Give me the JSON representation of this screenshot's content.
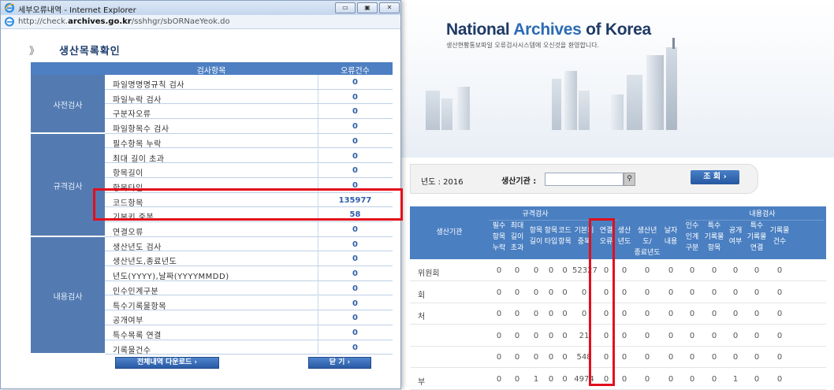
{
  "background_page": {
    "site_title_prefix": "National",
    "site_title_accent": "Archives",
    "site_title_suffix": "of Korea",
    "site_subtitle": "생산현황통보파일 오류검사시스템에 오신것을 환영합니다.",
    "search": {
      "year_label": "년도 : 2016",
      "agency_label": "생산기관 :",
      "agency_value": "",
      "query_button": "조 회 ›"
    },
    "table": {
      "col_agency": "생산기관",
      "group_format": "규격검사",
      "group_content": "내용검사",
      "columns": [
        "필수\n항목\n누락",
        "최대\n길이\n초과",
        "항목\n길이",
        "항목\n타입",
        "코드\n항목",
        "기본키\n중복",
        "연결\n오류",
        "생산\n년도",
        "생산년도/\n종료년도",
        "날자\n내용",
        "인수\n인계\n구분",
        "특수\n기록물\n항목",
        "공개\n여부",
        "특수\n기록물\n연결",
        "기록물\n건수"
      ],
      "rows": [
        {
          "name": "위원회",
          "values": [
            "0",
            "0",
            "0",
            "0",
            "0",
            "52327",
            "0",
            "0",
            "0",
            "0",
            "0",
            "0",
            "0",
            "0",
            "0"
          ]
        },
        {
          "name": "회",
          "values": [
            "0",
            "0",
            "0",
            "0",
            "0",
            "0",
            "0",
            "0",
            "0",
            "0",
            "0",
            "0",
            "0",
            "0",
            "0"
          ]
        },
        {
          "name": "처",
          "values": [
            "0",
            "0",
            "0",
            "0",
            "0",
            "0",
            "0",
            "0",
            "0",
            "0",
            "0",
            "0",
            "0",
            "0",
            "0"
          ]
        },
        {
          "name": "",
          "values": [
            "0",
            "0",
            "0",
            "0",
            "0",
            "21",
            "0",
            "0",
            "0",
            "0",
            "0",
            "0",
            "0",
            "0",
            "0"
          ]
        },
        {
          "name": "",
          "values": [
            "0",
            "0",
            "0",
            "0",
            "0",
            "548",
            "0",
            "0",
            "0",
            "0",
            "0",
            "0",
            "0",
            "0",
            "0"
          ]
        },
        {
          "name": "부",
          "values": [
            "0",
            "0",
            "1",
            "0",
            "0",
            "4974",
            "0",
            "0",
            "0",
            "0",
            "0",
            "0",
            "1",
            "0",
            "0"
          ]
        }
      ]
    }
  },
  "popup": {
    "window_title": "세부오류내역 - Internet Explorer",
    "url_prefix": "http://check.",
    "url_bold": "archives.go.kr",
    "url_suffix": "/sshhgr/sbORNaeYeok.do",
    "heading": "생산목록확인",
    "table": {
      "col_item": "검사항목",
      "col_count": "오류건수",
      "groups": [
        {
          "category": "사전검사",
          "rows": [
            {
              "label": "파일명명명규칙 검사",
              "count": "0"
            },
            {
              "label": "파일누락 검사",
              "count": "0"
            },
            {
              "label": "구분자오류",
              "count": "0"
            },
            {
              "label": "파일항목수 검사",
              "count": "0"
            }
          ]
        },
        {
          "category": "규격검사",
          "rows": [
            {
              "label": "필수항목 누락",
              "count": "0"
            },
            {
              "label": "최대 길이 초과",
              "count": "0"
            },
            {
              "label": "항목길이",
              "count": "0"
            },
            {
              "label": "항목타입",
              "count": "0"
            },
            {
              "label": "코드항목",
              "count": "135977"
            },
            {
              "label": "기본키 중복",
              "count": "58"
            },
            {
              "label": "연결오류",
              "count": "0"
            }
          ]
        },
        {
          "category": "내용검사",
          "rows": [
            {
              "label": "생산년도 검사",
              "count": "0"
            },
            {
              "label": "생산년도,종료년도",
              "count": "0"
            },
            {
              "label": "년도(YYYY),날짜(YYYYMMDD)",
              "count": "0"
            },
            {
              "label": "인수인계구분",
              "count": "0"
            },
            {
              "label": "특수기록물항목",
              "count": "0"
            },
            {
              "label": "공개여부",
              "count": "0"
            },
            {
              "label": "특수목록 연결",
              "count": "0"
            },
            {
              "label": "기록물건수",
              "count": "0"
            }
          ]
        }
      ]
    },
    "download_button": "전체내역 다운로드 ›",
    "close_button": "닫 기 ›"
  },
  "colors": {
    "accent": "#4d7fc2",
    "highlight": "#e10f1c",
    "category_bg": "#547bb1"
  }
}
